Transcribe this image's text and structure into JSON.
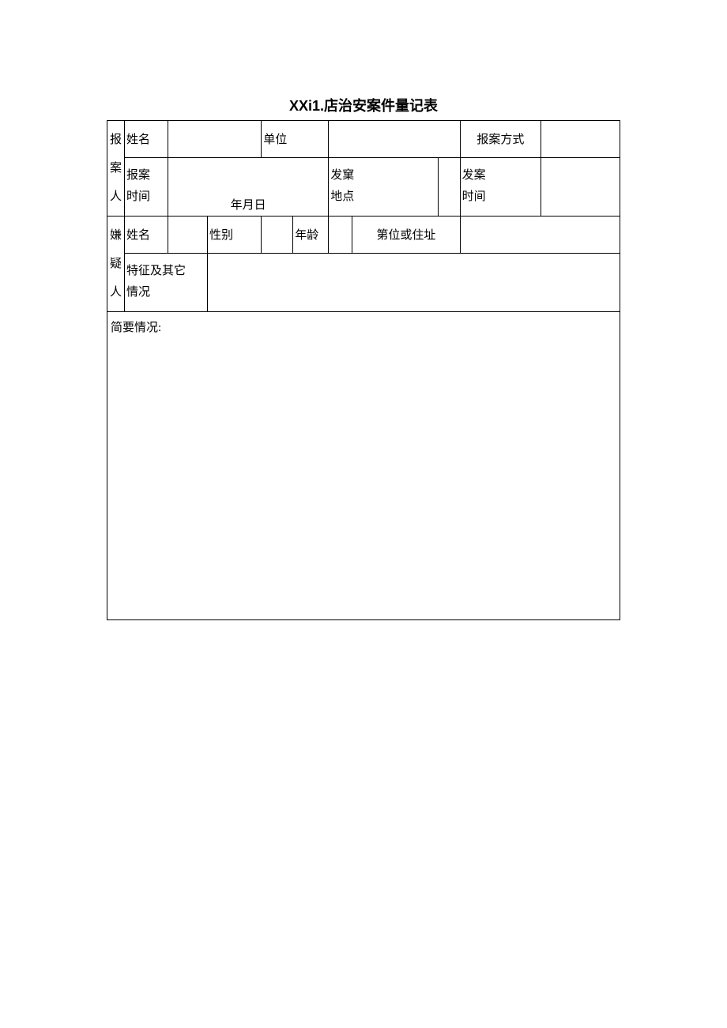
{
  "title": "XXi1.店治安案件量记表",
  "reporter": {
    "header": "报案人",
    "name_label": "姓名",
    "name_value": "",
    "unit_label": "单位",
    "unit_value": "",
    "method_label": "报案方式",
    "method_value": "",
    "report_time_label": "报案时间",
    "report_time_value": "年月日",
    "incident_location_label": "发窠地点",
    "incident_location_value": "",
    "incident_time_label": "发案时间",
    "incident_time_value": ""
  },
  "suspect": {
    "header": "嫌疑人",
    "name_label": "姓名",
    "name_value": "",
    "gender_label": "性别",
    "gender_value": "",
    "age_label": "年龄",
    "age_value": "",
    "address_label": "第位或住址",
    "address_value": "",
    "features_label": "特征及其它情况",
    "features_value": ""
  },
  "brief": {
    "label": "简要情况:",
    "value": ""
  }
}
